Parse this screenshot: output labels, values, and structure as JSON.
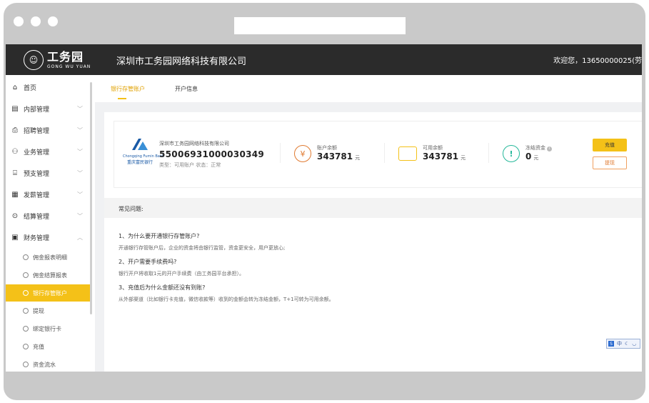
{
  "header": {
    "logo_cn": "工务园",
    "logo_en": "GONG WU YUAN",
    "company": "深圳市工务园网络科技有限公司",
    "welcome": "欢迎您，13650000025(劳"
  },
  "sidebar": {
    "items": [
      {
        "label": "首页",
        "icon": "home-icon",
        "glyph": "⌂"
      },
      {
        "label": "内部管理",
        "icon": "document-icon",
        "glyph": "▤"
      },
      {
        "label": "招聘管理",
        "icon": "printer-icon",
        "glyph": "⎙"
      },
      {
        "label": "业务管理",
        "icon": "user-icon",
        "glyph": "⚇"
      },
      {
        "label": "预支管理",
        "icon": "bank-icon",
        "glyph": "⌸"
      },
      {
        "label": "发薪管理",
        "icon": "calendar-icon",
        "glyph": "▦"
      },
      {
        "label": "结算管理",
        "icon": "target-icon",
        "glyph": "⊙"
      },
      {
        "label": "财务管理",
        "icon": "finance-icon",
        "glyph": "▣"
      }
    ],
    "sub_items": [
      {
        "label": "佣金报表明细"
      },
      {
        "label": "佣金结算报表"
      },
      {
        "label": "银行存管账户"
      },
      {
        "label": "提现"
      },
      {
        "label": "绑定银行卡"
      },
      {
        "label": "充值"
      },
      {
        "label": "资金流水"
      }
    ]
  },
  "tabs": [
    {
      "label": "银行存管账户"
    },
    {
      "label": "开户信息"
    }
  ],
  "account": {
    "bank_en": "Chongqing Fumin Bank",
    "bank_cn": "重庆富民银行",
    "company": "深圳市工务园网络科技有限公司",
    "account_no": "55006931000030349",
    "status_line": "类型：可用账户 状态：正常",
    "balance_label": "账户余额",
    "balance_value": "343781",
    "available_label": "可用余额",
    "available_value": "343781",
    "frozen_label": "冻结资金",
    "frozen_value": "0",
    "unit": "元",
    "recharge_label": "充值",
    "withdraw_label": "提现"
  },
  "faq": {
    "title": "常见问题:",
    "items": [
      {
        "q": "1、为什么要开通银行存管账户?",
        "a": "开通银行存管账户后，企业的资金将由银行监管，资金更安全，用户更放心;"
      },
      {
        "q": "2、开户需要手续费吗?",
        "a": "银行开户将收取1元的开户手续费（由工务园平台承担）。"
      },
      {
        "q": "3、充值后为什么金额还没有到账?",
        "a": "从外部渠道（比如银行卡充值，微信收款等）收到的金额会转为冻结金额，T+1可转为可用余额。"
      }
    ]
  },
  "ime": {
    "label": "中"
  },
  "colors": {
    "accent": "#f4c118",
    "topbar": "#2b2b2b",
    "bank_blue": "#1a5aa6",
    "withdraw": "#e07a30"
  }
}
